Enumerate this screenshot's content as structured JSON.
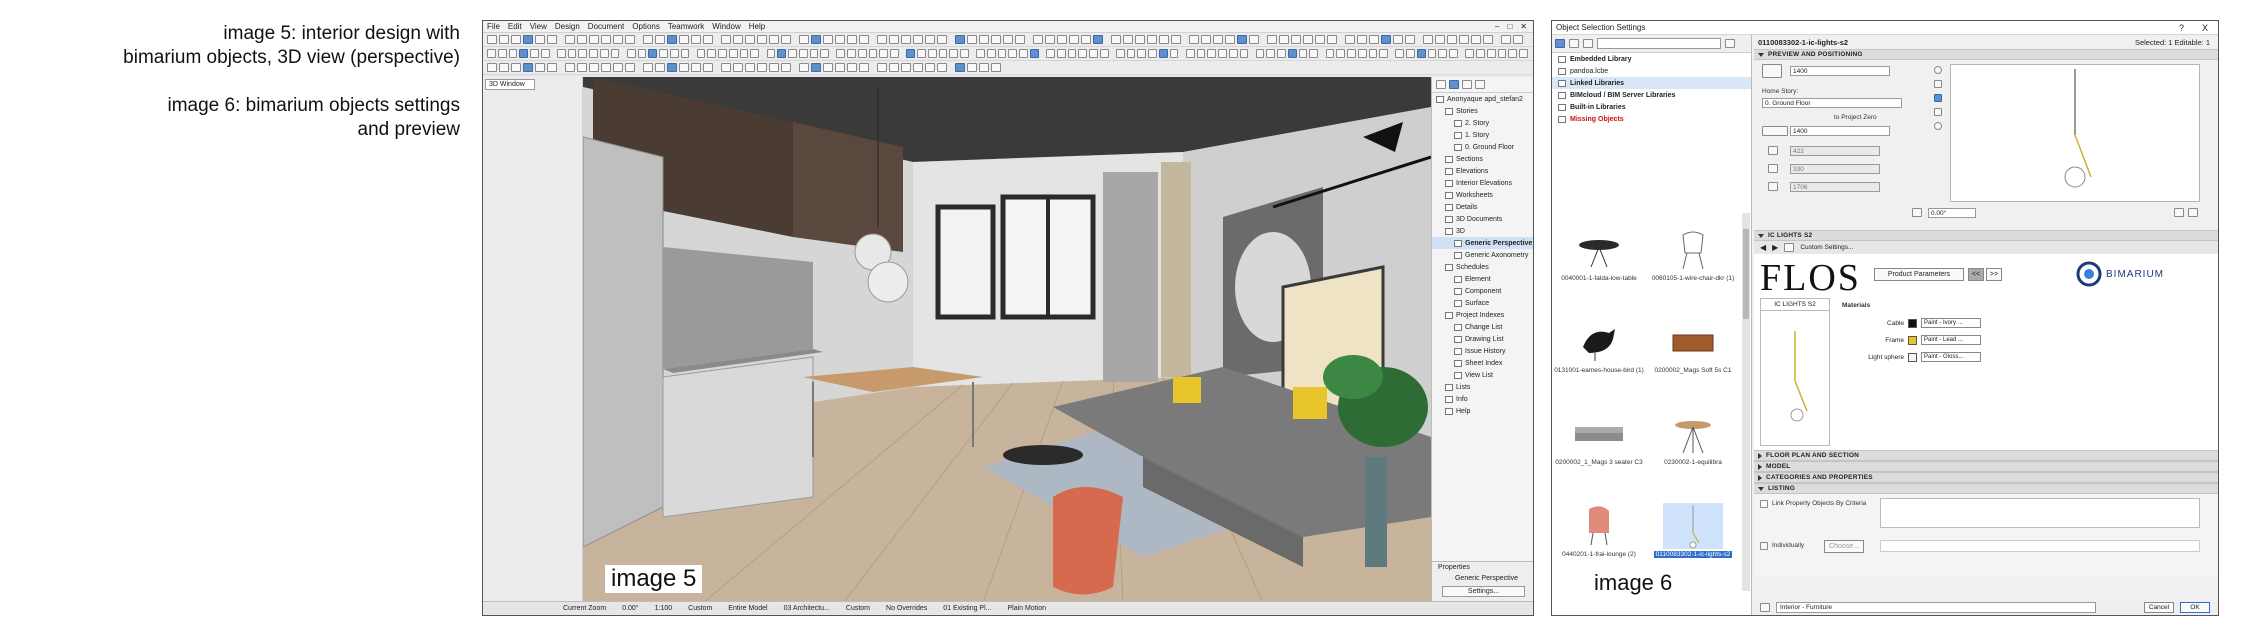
{
  "captions": {
    "image5": "image 5: interior design with\nbimarium objects, 3D view (perspective)",
    "image6": "image 6: bimarium objects settings\nand preview"
  },
  "archicad": {
    "label": "image 5",
    "menu": [
      "File",
      "Edit",
      "View",
      "Design",
      "Document",
      "Options",
      "Teamwork",
      "Window",
      "Help"
    ],
    "toolbox_tab": "3D Window",
    "navigator": {
      "project": "Anonyaque apd_stefan2",
      "items": [
        {
          "label": "Stories",
          "level": 1
        },
        {
          "label": "2. Story",
          "level": 2
        },
        {
          "label": "1. Story",
          "level": 2
        },
        {
          "label": "0. Ground Floor",
          "level": 2
        },
        {
          "label": "Sections",
          "level": 1
        },
        {
          "label": "Elevations",
          "level": 1
        },
        {
          "label": "Interior Elevations",
          "level": 1
        },
        {
          "label": "Worksheets",
          "level": 1
        },
        {
          "label": "Details",
          "level": 1
        },
        {
          "label": "3D Documents",
          "level": 1
        },
        {
          "label": "3D",
          "level": 1
        },
        {
          "label": "Generic Perspective",
          "level": 2,
          "selected": true
        },
        {
          "label": "Generic Axonometry",
          "level": 2
        },
        {
          "label": "Schedules",
          "level": 1
        },
        {
          "label": "Element",
          "level": 2
        },
        {
          "label": "Component",
          "level": 2
        },
        {
          "label": "Surface",
          "level": 2
        },
        {
          "label": "Project Indexes",
          "level": 1
        },
        {
          "label": "Change List",
          "level": 2
        },
        {
          "label": "Drawing List",
          "level": 2
        },
        {
          "label": "Issue History",
          "level": 2
        },
        {
          "label": "Sheet Index",
          "level": 2
        },
        {
          "label": "View List",
          "level": 2
        },
        {
          "label": "Lists",
          "level": 1
        },
        {
          "label": "Info",
          "level": 1
        },
        {
          "label": "Help",
          "level": 1
        }
      ],
      "properties_title": "Properties",
      "properties_value": "Generic Perspective",
      "settings_button": "Settings..."
    },
    "status": [
      "Current Zoom",
      "0.00°",
      "1:100",
      "Custom",
      "Entire Model",
      "03 Architectu...",
      "Custom",
      "No Overrides",
      "01 Existing Pl...",
      "Plain Motion"
    ]
  },
  "object_settings": {
    "label": "image 6",
    "window_title": "Object Selection Settings",
    "window_controls": [
      "?",
      "X"
    ],
    "libraries": [
      {
        "label": "Embedded Library",
        "style": "b"
      },
      {
        "label": "pandoa.lcbe",
        "style": ""
      },
      {
        "label": "Linked Libraries",
        "style": "b sel"
      },
      {
        "label": "BIMcloud / BIM Server Libraries",
        "style": "b"
      },
      {
        "label": "Built-in Libraries",
        "style": "b"
      },
      {
        "label": "Missing Objects",
        "style": "red"
      }
    ],
    "thumbnails": [
      "0040001-1-falda-low-table",
      "0060105-1-wire-chair-dkr (1)",
      "0131001-eames-house-bird (1)",
      "0200002_Mags Soft 5s C1",
      "0200002_1_Mags 3 seater C3",
      "0230002-1-equilibra",
      "0440201-1-frai-lounge (2)",
      "0110083302-1-ic-lights-s2"
    ],
    "selected_id": "0110083302-1-ic-lights-s2",
    "selection_info": "Selected: 1 Editable: 1",
    "sections": {
      "preview": "PREVIEW AND POSITIONING",
      "params": "IC LIGHTS S2",
      "floor_plan": "FLOOR PLAN AND SECTION",
      "model": "MODEL",
      "categories": "CATEGORIES AND PROPERTIES",
      "listing": "LISTING"
    },
    "positioning": {
      "height": "1400",
      "home_story_label": "Home Story:",
      "home_story": "0. Ground Floor",
      "to_project_zero": "to Project Zero",
      "elevation": "1400",
      "dim1": "422",
      "dim2": "330",
      "dim3": "1706",
      "angle": "0.00°"
    },
    "params": {
      "custom_settings": "Custom Settings...",
      "brand": "FLOS",
      "product_params_button": "Product Parameters",
      "nav_buttons": [
        "<<",
        ">>"
      ],
      "preview_title": "IC LIGHTS S2",
      "materials_title": "Materials",
      "materials": [
        {
          "label": "Cable",
          "value": "Paint - Ivory ...",
          "color": "#111111"
        },
        {
          "label": "Frame",
          "value": "Paint - Lead ...",
          "color": "#e7c52b"
        },
        {
          "label": "Light sphere",
          "value": "Paint - Gloss...",
          "color": "#f4f4f4"
        }
      ],
      "logo_text": "BIMARIUM"
    },
    "listing": {
      "link_criteria": "Link Property Objects By Criteria",
      "individually": "Individually",
      "choose_button": "Choose..."
    },
    "footer": {
      "layer": "Interior - Furniture",
      "cancel": "Cancel",
      "ok": "OK"
    }
  }
}
